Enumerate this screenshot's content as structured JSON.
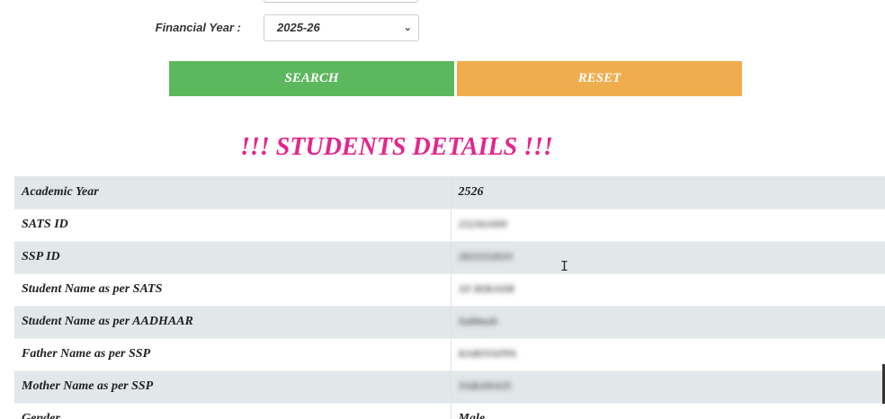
{
  "filters": {
    "financial_year_label": "Financial Year :",
    "financial_year_value": "2025-26"
  },
  "actions": {
    "search_label": "SEARCH",
    "reset_label": "RESET"
  },
  "section": {
    "title": "!!! STUDENTS DETAILS !!!"
  },
  "details": [
    {
      "label": "Academic Year",
      "value": "2526"
    },
    {
      "label": "SATS ID",
      "value": "252361099"
    },
    {
      "label": "SSP ID",
      "value": "2025552019"
    },
    {
      "label": "Student Name as per SATS",
      "value": "AY BIRADR"
    },
    {
      "label": "Student Name as per AADHAAR",
      "value": "Subhash"
    },
    {
      "label": "Father Name as per SSP",
      "value": "KARIYAPPA"
    },
    {
      "label": "Mother Name as per SSP",
      "value": "TARAWATI"
    },
    {
      "label": "Gender",
      "value": "Male"
    }
  ],
  "colors": {
    "search_button": "#5cb85c",
    "reset_button": "#f0ad4e",
    "title": "#e6248c",
    "row_alt": "#e2e7ea"
  }
}
